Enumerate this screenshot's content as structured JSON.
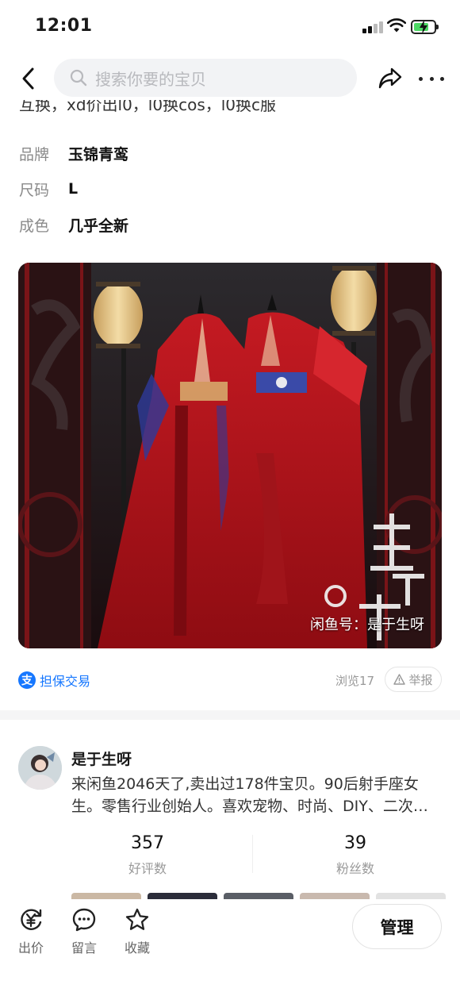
{
  "status_bar": {
    "time": "12:01"
  },
  "nav": {
    "search_placeholder": "搜索你要的宝贝",
    "icons": {
      "back": "chevron-left-icon",
      "search": "search-icon",
      "share": "share-icon",
      "more": "more-icon"
    }
  },
  "description_partial": "互换，xd价出l0，l0换cos，l0换c服",
  "attributes": [
    {
      "key": "品牌",
      "value": "玉锦青鸾"
    },
    {
      "key": "尺码",
      "value": "L"
    },
    {
      "key": "成色",
      "value": "几乎全新"
    }
  ],
  "photo": {
    "watermark": "闲鱼号：是于生呀",
    "logo_text": "玉锦青鸾"
  },
  "meta": {
    "guarantee_label": "担保交易",
    "guarantee_icon_text": "支",
    "views": "浏览17",
    "report_label": "举报"
  },
  "seller": {
    "name": "是于生呀",
    "bio": "来闲鱼2046天了,卖出过178件宝贝。90后射手座女生。零售行业创始人。喜欢宠物、时尚、DIY、二次…",
    "stats": [
      {
        "value": "357",
        "label": "好评数"
      },
      {
        "value": "39",
        "label": "粉丝数"
      }
    ]
  },
  "bottom_bar": {
    "actions": [
      {
        "label": "出价",
        "icon": "bid-yuan-icon"
      },
      {
        "label": "留言",
        "icon": "comment-icon"
      },
      {
        "label": "收藏",
        "icon": "star-icon"
      }
    ],
    "manage_label": "管理"
  },
  "colors": {
    "accent_blue": "#1677ff",
    "robe_red": "#b3121b",
    "battery_green": "#4cd964"
  }
}
